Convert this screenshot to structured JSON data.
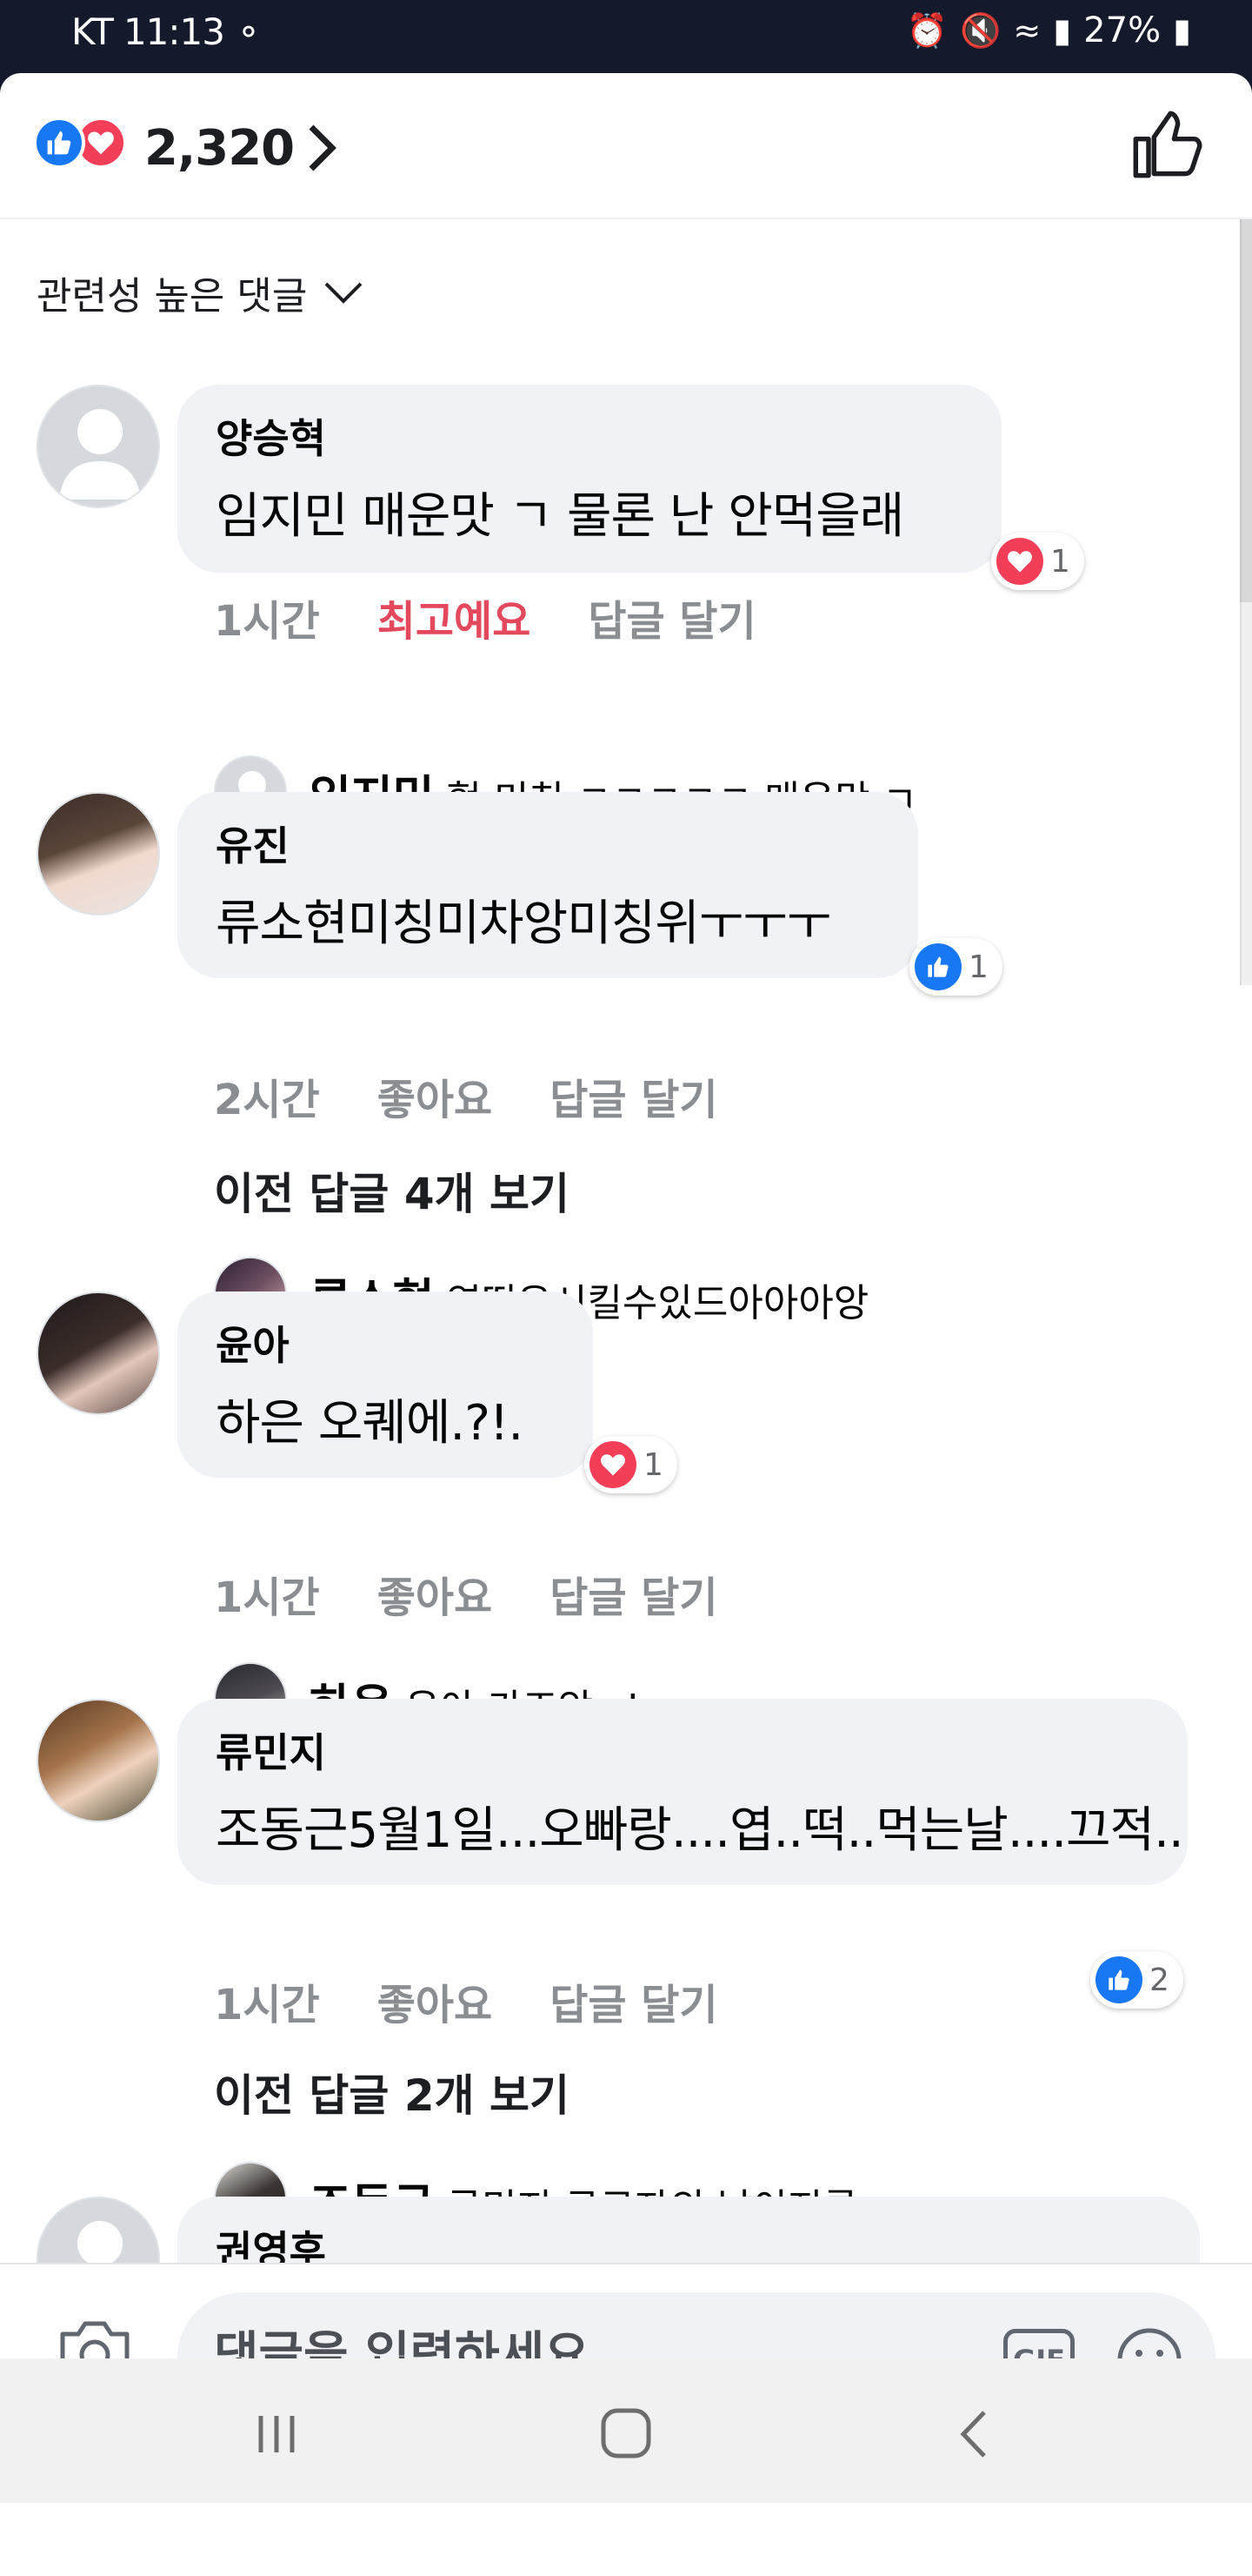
{
  "status_bar": {
    "carrier": "KT",
    "time": "11:13",
    "battery": "27%"
  },
  "reactions": {
    "count": "2,320"
  },
  "sort": {
    "label": "관련성 높은 댓글"
  },
  "comments": [
    {
      "author": "양승혁",
      "text": "임지민 매운맛 ㄱ 물론 난 안먹을래",
      "reaction_count": "1",
      "reaction_type": "love",
      "time": "1시간",
      "like_label": "최고예요",
      "reply_label": "답글 달기",
      "reply": {
        "author": "임지민",
        "text": "헐 미친 ㅋㅋㅋㅋㅋ 매운맛 ㄱ"
      }
    },
    {
      "author": "유진",
      "text": "류소현미칭미차앙미칭위ㅜㅜㅜ",
      "reaction_count": "1",
      "reaction_type": "like",
      "time": "2시간",
      "like_label": "좋아요",
      "reply_label": "답글 달기",
      "view_previous": "이전 답글 4개 보기",
      "reply": {
        "author": "류소현",
        "text": "엽떡은시킬수있드아아아앙"
      }
    },
    {
      "author": "윤아",
      "text": "하은 오퀘에.?!.",
      "reaction_count": "1",
      "reaction_type": "love",
      "time": "1시간",
      "like_label": "좋아요",
      "reply_label": "답글 달기",
      "reply": {
        "author": "하은",
        "text": "윤아 가즈앙~!"
      }
    },
    {
      "author": "류민지",
      "text": "조동근5월1일...오빠랑....엽..떡..먹는날....끄적..",
      "reaction_count": "2",
      "reaction_type": "like",
      "time": "1시간",
      "like_label": "좋아요",
      "reply_label": "답글 달기",
      "view_previous": "이전 답글 2개 보기",
      "reply": {
        "author": "조동근",
        "text": "류민지 근로자의 날이지롱~~~~~~"
      }
    },
    {
      "author": "권영후"
    }
  ],
  "composer": {
    "placeholder": "댓글을 입력하세요...",
    "gif_label": "GIF"
  },
  "colors": {
    "like_blue": "#1877f2",
    "love_red": "#f33e58",
    "loved_text": "#e4485c",
    "bubble_bg": "#f0f2f5"
  }
}
